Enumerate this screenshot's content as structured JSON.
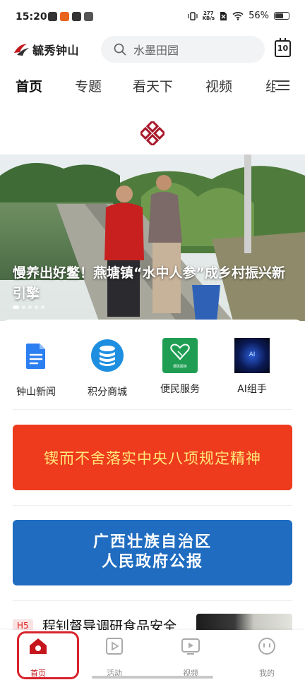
{
  "status_bar": {
    "time": "15:20",
    "net_speed_value": "277",
    "net_speed_unit": "KB/s",
    "battery": "56%"
  },
  "header": {
    "logo_text": "毓秀钟山",
    "search_placeholder": "水墨田园",
    "calendar_day": "10"
  },
  "tabs": [
    {
      "label": "首页",
      "active": true
    },
    {
      "label": "专题"
    },
    {
      "label": "看天下"
    },
    {
      "label": "视频"
    },
    {
      "label": "组"
    }
  ],
  "banner": {
    "title": "慢养出好鳖！燕塘镇“水中人参”成乡村振兴新引擎",
    "slide_count": 5,
    "active_slide": 1
  },
  "quick_links": [
    {
      "label": "钟山新闻",
      "icon": "document-icon"
    },
    {
      "label": "积分商城",
      "icon": "database-coins-icon"
    },
    {
      "label": "便民服务",
      "icon": "handshake-service-icon",
      "icon_caption": "便民服务"
    },
    {
      "label": "AI组手",
      "icon": "ai-icon",
      "icon_caption": "AI"
    }
  ],
  "promos": [
    {
      "text": "锲而不舍落实中央八项规定精神"
    },
    {
      "line1": "广西壮族自治区",
      "line2": "人民政府公报"
    }
  ],
  "news": [
    {
      "tag": "H5",
      "title": "程钊督导调研食品安全"
    }
  ],
  "bottom_nav": [
    {
      "label": "首页",
      "icon": "home-icon",
      "active": true
    },
    {
      "label": "活动",
      "icon": "play-square-icon"
    },
    {
      "label": "视频",
      "icon": "video-icon"
    },
    {
      "label": "我的",
      "icon": "profile-face-icon"
    }
  ],
  "colors": {
    "brand_red": "#c4161c",
    "promo_red": "#ee3a1d",
    "promo_yellow": "#ffe87a",
    "promo_blue": "#1f6cc0"
  }
}
